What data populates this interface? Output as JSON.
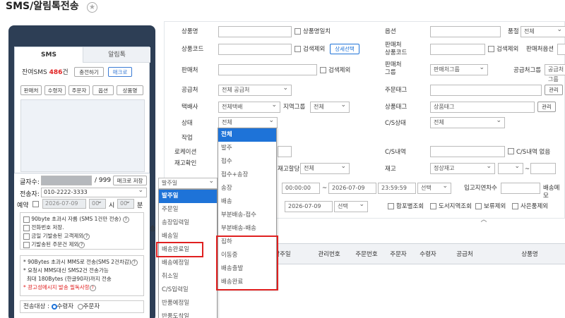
{
  "title": "SMS/알림톡전송",
  "phone": {
    "tabs": [
      "SMS",
      "알림톡"
    ],
    "remain_prefix": "잔여SMS ",
    "remain_count": "486",
    "remain_suffix": "건",
    "charge_btn": "충전하기",
    "macro_btn": "매크로",
    "insert_btns": [
      "판매처",
      "수령자",
      "주문자",
      "옵션",
      "상품명"
    ],
    "chars_label": "글자수:",
    "chars_max": "/ 999",
    "macro_save_btn": "매크로 저장",
    "sender_label": "전송자:",
    "sender_value": "010-2222-3333",
    "reserve_label": "예약",
    "reserve_date": "2026-07-09",
    "reserve_hour": "00",
    "reserve_hour_unit": "시",
    "reserve_min": "00",
    "reserve_min_unit": "분",
    "options": [
      "90byte 초과시 자름 (SMS 1건만 전송)",
      "전화번호 저장.",
      "금일 기발송된 고객제외",
      "기발송된 주문건 제외"
    ],
    "notes": [
      "90Bytes 초과시 MMS로 전송(SMS 2건차감)",
      "요청시 MMS대신 SMS2건 전송가능",
      "최대 180Bytes (한글90자)까지 전송",
      "광고성메시지 발송 필독사항"
    ],
    "target_label": "전송대상 :",
    "target_options": [
      "수령자",
      "주문자"
    ]
  },
  "filter": {
    "labels": {
      "product_name": "상품명",
      "product_exact": "상품명일치",
      "option": "옵션",
      "quality": "품절",
      "product_code": "상품코드",
      "search_exclude": "검색제외",
      "detail_select": "상세선택",
      "seller_code": "판매처\n상품코드",
      "seller_option": "판매처옵션",
      "seller": "판매처",
      "seller_group": "판매처\n그룹",
      "supplier_group": "공급처그룹",
      "supplier": "공급처",
      "order_tag": "주문태그",
      "manage": "관리",
      "courier": "택배사",
      "region_group": "지역그룹",
      "product_tag": "상품태그",
      "status": "상태",
      "cs_status": "C/S상태",
      "work": "작업",
      "location": "로케이션",
      "cs_detail": "C/S내역",
      "no_cs": "C/S내역 없음",
      "stock_check": "재고확인",
      "stock_alloc": "재고할당",
      "stock": "재고",
      "tilde": "~",
      "time_start": "00:00:00",
      "date_end": "2026-07-09",
      "time_end": "23:59:59",
      "select": "선택",
      "delay_count": "입고지연차수",
      "delivery_memo": "배송메모",
      "date_end2": "2026-07-09",
      "merge_view": "합포별조회",
      "island": "도서지역조회",
      "hold_exclude": "보류제외",
      "gift_exclude": "사은품제외"
    },
    "values": {
      "quality_sel": "전체",
      "seller_group_sel": "판매처그룹",
      "supplier_group_sel": "공급처그룹",
      "supplier_sel": "전체 공급처",
      "courier_sel": "전체택배",
      "region_sel": "전체",
      "product_tag_val": "상품태그",
      "status_sel": "전체",
      "cs_status_sel": "전체",
      "stock_alloc_sel": "전체",
      "stock_sel": "정상재고",
      "date_type_sel": "발주일"
    }
  },
  "status_dropdown": [
    "전체",
    "발주",
    "접수",
    "접수+송장",
    "송장",
    "배송",
    "부분배송-접수",
    "부분배송-배송",
    "집하",
    "이동중",
    "배송출발",
    "배송완료"
  ],
  "date_dropdown": [
    "발주일",
    "주문일",
    "송장입력일",
    "배송일",
    "배송완료일",
    "배송예정일",
    "취소일",
    "C/S입력일",
    "반품예정일",
    "반품도착일"
  ],
  "table_headers": [
    "발주일",
    "관리번호",
    "주문번호",
    "주문자",
    "수령자",
    "공급처",
    "상품명"
  ],
  "misc": {
    "tab_label": "송"
  },
  "colors": {
    "phone_bg": "#2d3e55",
    "accent_blue": "#1e73d8",
    "highlight_red": "#e02020"
  }
}
